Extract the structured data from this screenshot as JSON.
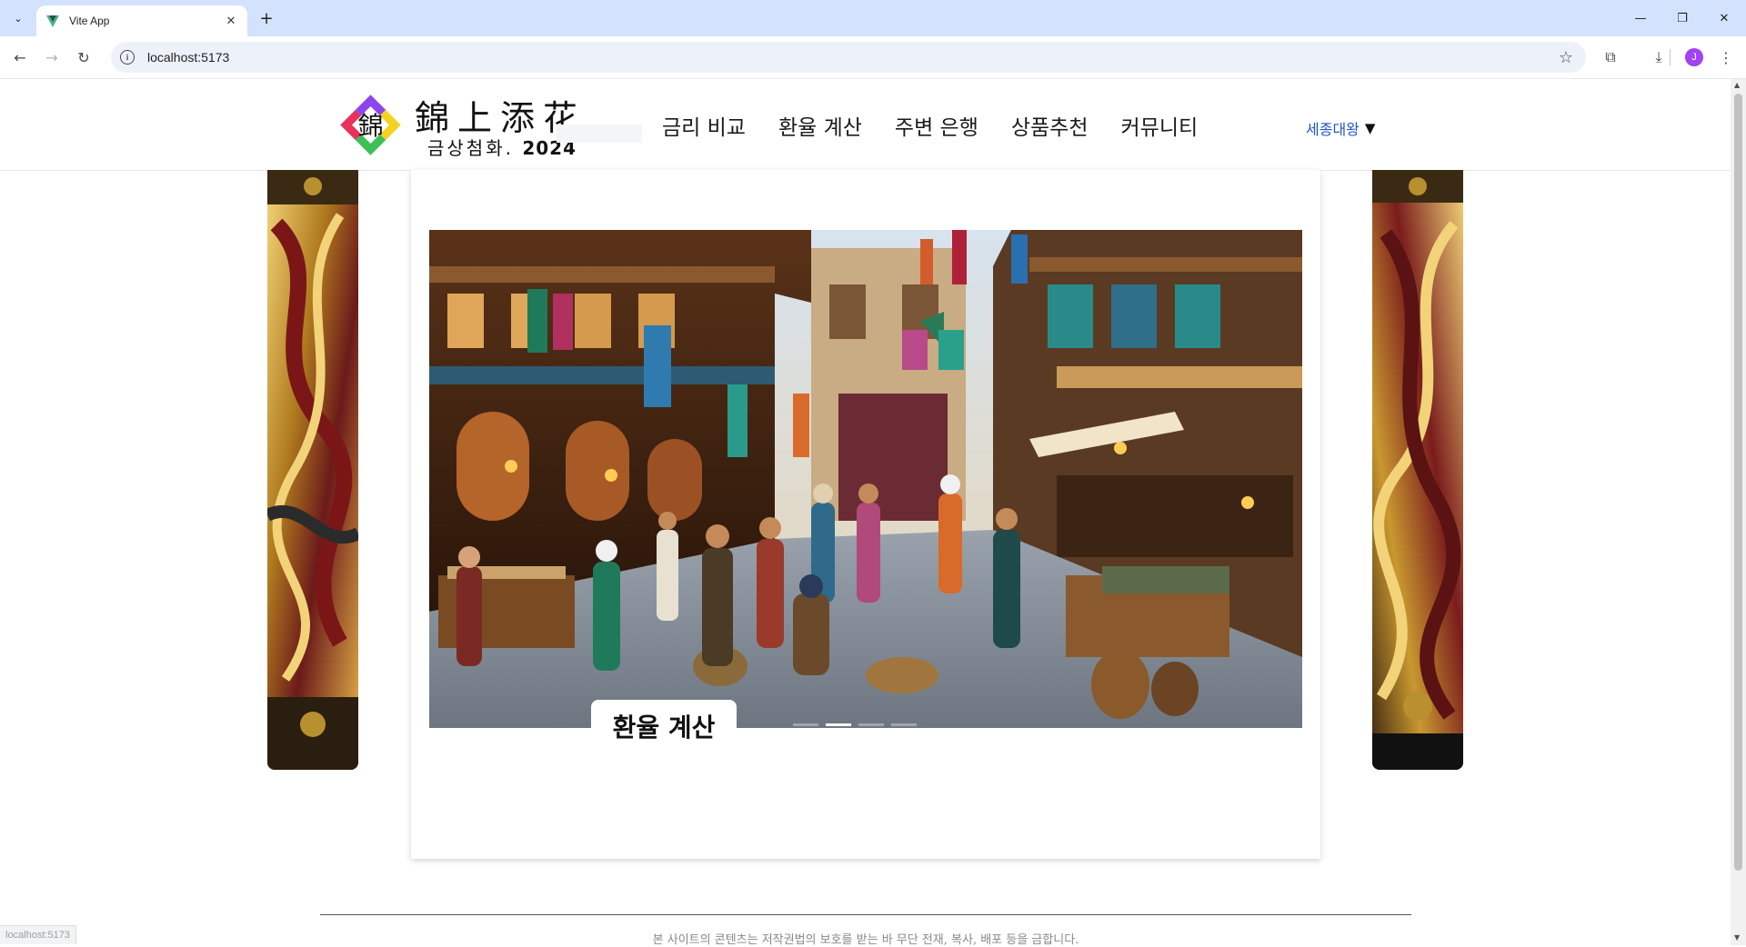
{
  "browser": {
    "tab_title": "Vite App",
    "url": "localhost:5173",
    "new_tab_label": "+",
    "profile_initial": "J",
    "status_url": "localhost:5173"
  },
  "site": {
    "brand_hanja": "錦上添花",
    "brand_sub": "금상첨화.",
    "brand_year": "2024",
    "logo_char": "錦",
    "nav": [
      {
        "label": "금리 비교"
      },
      {
        "label": "환율 계산"
      },
      {
        "label": "주변 은행"
      },
      {
        "label": "상품추천"
      },
      {
        "label": "커뮤니티"
      }
    ],
    "user_name": "세종대왕",
    "user_caret": "▼"
  },
  "carousel": {
    "active_label": "환율 계산",
    "slide_count": 4,
    "active_index": 1
  },
  "footer": {
    "copyright": "본 사이트의 콘텐츠는 저작권법의 보호를 받는 바 무단 전재, 복사, 배포 등을 금합니다."
  },
  "colors": {
    "accent_blue": "#1f55c6",
    "tab_strip": "#d3e3fd",
    "omnibox": "#edf2fa",
    "gold": "#c9982f",
    "crimson": "#7a1c1c"
  }
}
